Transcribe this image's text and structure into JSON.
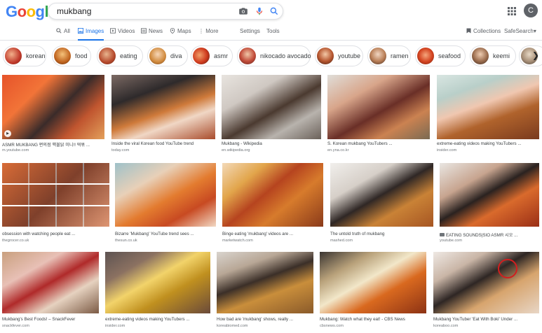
{
  "app": {
    "logo_letters": [
      "G",
      "o",
      "o",
      "g",
      "l",
      "e"
    ],
    "logo_colors": [
      "#4285f4",
      "#ea4335",
      "#fbbc05",
      "#4285f4",
      "#34a853",
      "#ea4335"
    ]
  },
  "search": {
    "query": "mukbang"
  },
  "tabs": [
    {
      "label": "All",
      "icon": "search-icon"
    },
    {
      "label": "Images",
      "icon": "image-icon",
      "active": true
    },
    {
      "label": "Videos",
      "icon": "video-icon"
    },
    {
      "label": "News",
      "icon": "news-icon"
    },
    {
      "label": "Maps",
      "icon": "map-pin-icon"
    },
    {
      "label": "More",
      "icon": "more-vert-icon"
    }
  ],
  "tools": {
    "settings": "Settings",
    "tools": "Tools",
    "collections": "Collections",
    "safesearch": "SafeSearch"
  },
  "user": {
    "initial": "C"
  },
  "chips": [
    "korean",
    "food",
    "eating",
    "diva",
    "asmr",
    "nikocado avocado",
    "youtube",
    "ramen",
    "seafood",
    "keemi"
  ],
  "results": {
    "row1": [
      {
        "caption": "ASMR MUKBANG 편의점 핵불닭 미니!! 떡볶 ...",
        "source": "m.youtube.com"
      },
      {
        "caption": "Inside the viral Korean food YouTube trend",
        "source": "today.com"
      },
      {
        "caption": "Mukbang - Wikipedia",
        "source": "en.wikipedia.org"
      },
      {
        "caption": "S. Korean mukbang YouTubers ...",
        "source": "en.yna.co.kr"
      },
      {
        "caption": "extreme-eating videos making YouTubers ...",
        "source": "insider.com"
      }
    ],
    "row2": [
      {
        "caption": "obsession with watching people eat ...",
        "source": "thegrocer.co.uk"
      },
      {
        "caption": "Bizarre 'Mukbang' YouTube trend sees ...",
        "source": "thesun.co.uk"
      },
      {
        "caption": "Binge eating 'mukbang' videos are ...",
        "source": "marketwatch.com"
      },
      {
        "caption": "The untold truth of mukbang",
        "source": "mashed.com"
      },
      {
        "caption": "EATING SOUNDS|SIO ASMR 시오 ...",
        "source": "youtube.com"
      }
    ],
    "row3": [
      {
        "caption": "Mukbang's Best Foods! – SnackFever",
        "source": "snackfever.com"
      },
      {
        "caption": "extreme-eating videos making YouTubers ...",
        "source": "insider.com"
      },
      {
        "caption": "How bad are 'mukbang' shows, really ...",
        "source": "koreabiomed.com"
      },
      {
        "caption": "Mukbang: Watch what they eat! - CBS News",
        "source": "cbsnews.com"
      },
      {
        "caption": "Mukbang YouTuber 'Eat With Boki' Under ...",
        "source": "koreaboo.com"
      }
    ]
  }
}
